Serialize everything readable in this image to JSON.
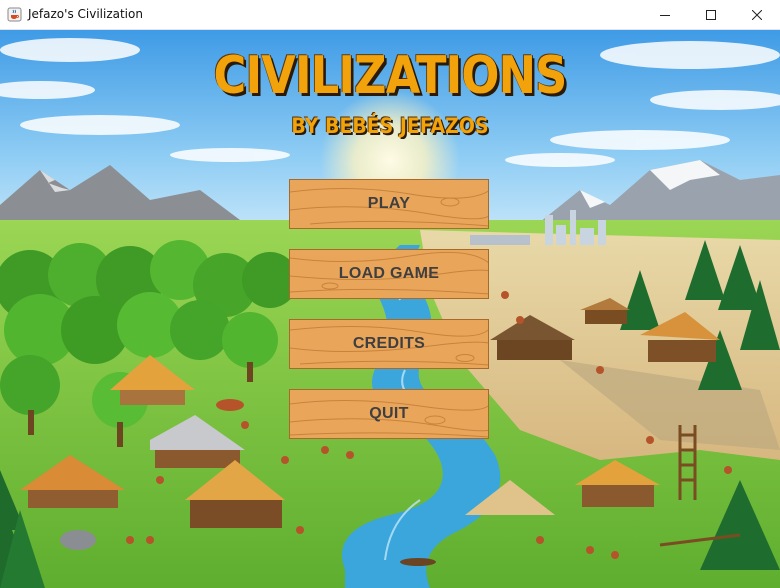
{
  "window": {
    "title": "Jefazo's Civilization",
    "icon": "java-cup-icon",
    "controls": [
      "minimize-icon",
      "maximize-icon",
      "close-icon"
    ]
  },
  "game": {
    "title": "CIVILIZATIONS",
    "subtitle": "BY BEBÉS JEFAZOS"
  },
  "menu": {
    "play": "PLAY",
    "load_game": "LOAD GAME",
    "credits": "CREDITS",
    "quit": "QUIT"
  },
  "colors": {
    "title_gold": "#f2a20a",
    "button_wood": "#e9a65b",
    "button_text": "#3f3f3f",
    "sky": "#5fb2ec",
    "river": "#3aa6dc",
    "grass": "#6cc43c"
  }
}
